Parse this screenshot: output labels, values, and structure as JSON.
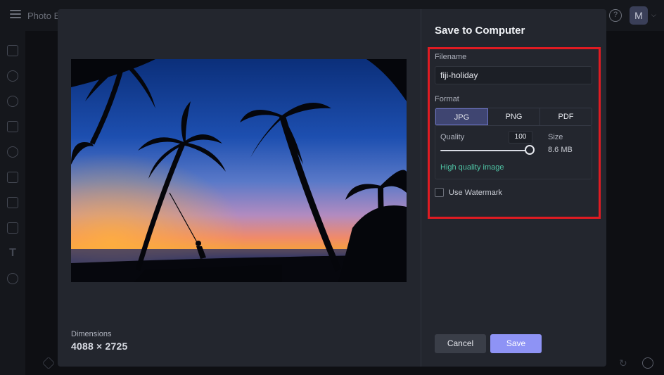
{
  "app": {
    "title": "Photo E",
    "avatar_initial": "M",
    "help_glyph": "?"
  },
  "dialog": {
    "title": "Save to Computer",
    "filename_label": "Filename",
    "filename_value": "fiji-holiday",
    "format_label": "Format",
    "formats": [
      "JPG",
      "PNG",
      "PDF"
    ],
    "selected_format": "JPG",
    "quality_label": "Quality",
    "quality_value": "100",
    "size_label": "Size",
    "size_value": "8.6 MB",
    "quality_note": "High quality image",
    "watermark_label": "Use Watermark",
    "watermark_checked": false,
    "dimensions_label": "Dimensions",
    "dimensions_value": "4088 × 2725",
    "cancel_label": "Cancel",
    "save_label": "Save"
  },
  "colors": {
    "accent": "#8e93f5",
    "highlight": "#e01b22",
    "quality_note": "#4fc4a5",
    "selected_segment": "#3f4571"
  }
}
